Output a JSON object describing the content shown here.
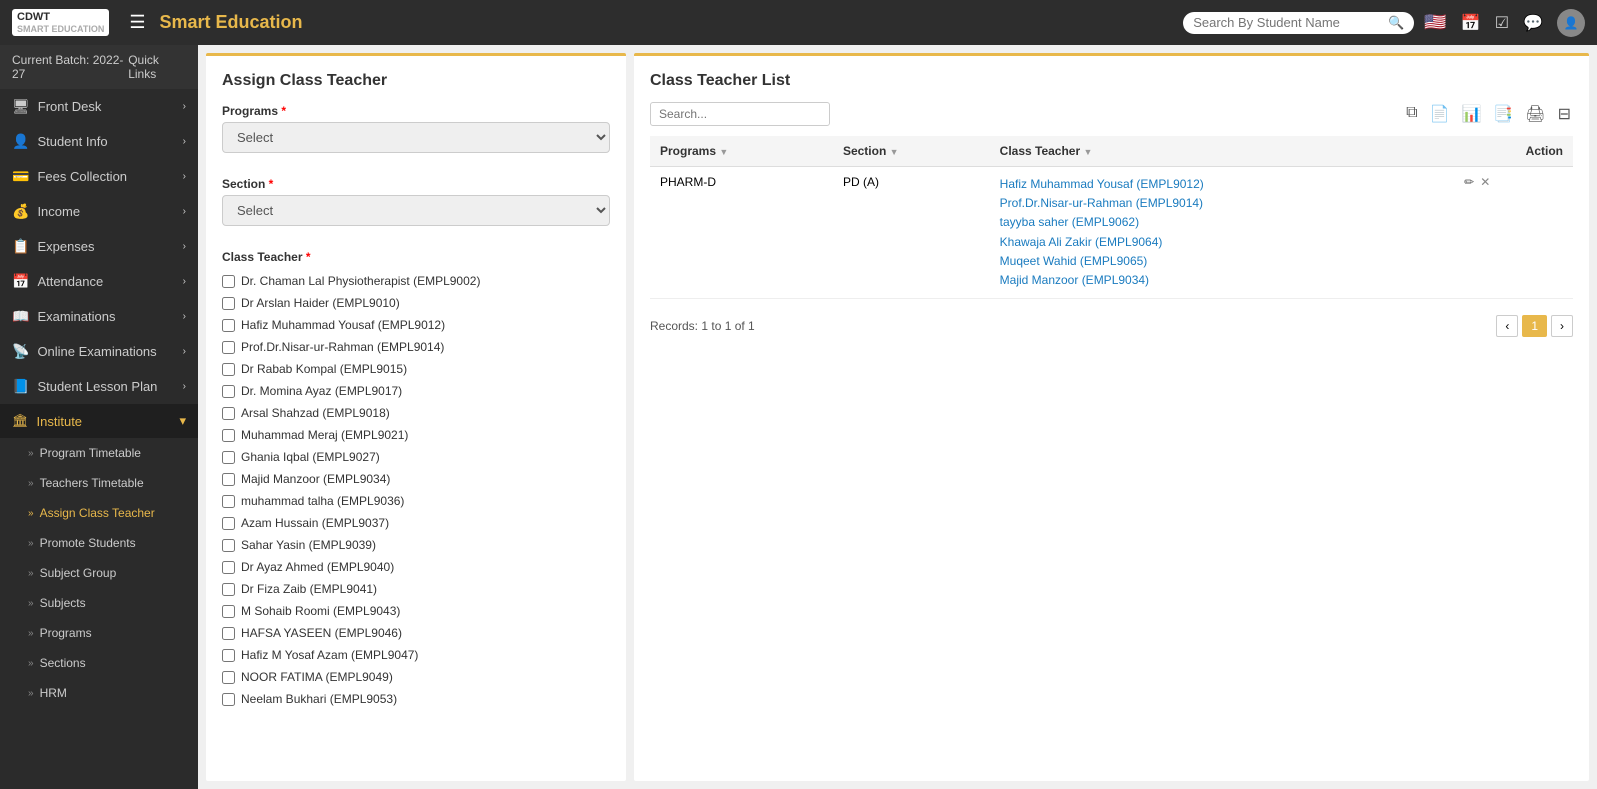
{
  "topnav": {
    "logo_line1": "CDWT",
    "logo_line2": "SMART EDUCATION",
    "app_title": "Smart Education",
    "search_placeholder": "Search By Student Name",
    "hamburger_label": "☰"
  },
  "sidebar": {
    "batch_label": "Current Batch: 2022-27",
    "quick_links_label": "Quick Links",
    "items": [
      {
        "id": "front-desk",
        "label": "Front Desk",
        "icon": "🖥",
        "has_chevron": true
      },
      {
        "id": "student-info",
        "label": "Student Info",
        "icon": "👤",
        "has_chevron": true
      },
      {
        "id": "fees-collection",
        "label": "Fees Collection",
        "icon": "💳",
        "has_chevron": true
      },
      {
        "id": "income",
        "label": "Income",
        "icon": "💰",
        "has_chevron": true
      },
      {
        "id": "expenses",
        "label": "Expenses",
        "icon": "📋",
        "has_chevron": true
      },
      {
        "id": "attendance",
        "label": "Attendance",
        "icon": "📅",
        "has_chevron": true
      },
      {
        "id": "examinations",
        "label": "Examinations",
        "icon": "📖",
        "has_chevron": true
      },
      {
        "id": "online-examinations",
        "label": "Online Examinations",
        "icon": "📡",
        "has_chevron": true
      },
      {
        "id": "student-lesson-plan",
        "label": "Student Lesson Plan",
        "icon": "📘",
        "has_chevron": true
      }
    ],
    "institute_label": "Institute",
    "sub_items": [
      {
        "id": "program-timetable",
        "label": "Program Timetable",
        "active": false
      },
      {
        "id": "teachers-timetable",
        "label": "Teachers Timetable",
        "active": false
      },
      {
        "id": "assign-class-teacher",
        "label": "Assign Class Teacher",
        "active": true
      },
      {
        "id": "promote-students",
        "label": "Promote Students",
        "active": false
      },
      {
        "id": "subject-group",
        "label": "Subject Group",
        "active": false
      },
      {
        "id": "subjects",
        "label": "Subjects",
        "active": false
      },
      {
        "id": "programs",
        "label": "Programs",
        "active": false
      },
      {
        "id": "sections",
        "label": "Sections",
        "active": false
      },
      {
        "id": "hrm",
        "label": "HRM",
        "active": false
      }
    ]
  },
  "assign_form": {
    "title": "Assign Class Teacher",
    "programs_label": "Programs",
    "programs_placeholder": "Select",
    "section_label": "Section",
    "section_placeholder": "Select",
    "class_teacher_label": "Class Teacher",
    "teachers": [
      "Dr. Chaman Lal Physiotherapist (EMPL9002)",
      "Dr Arslan Haider (EMPL9010)",
      "Hafiz Muhammad Yousaf (EMPL9012)",
      "Prof.Dr.Nisar-ur-Rahman (EMPL9014)",
      "Dr Rabab Kompal (EMPL9015)",
      "Dr. Momina Ayaz (EMPL9017)",
      "Arsal Shahzad (EMPL9018)",
      "Muhammad Meraj (EMPL9021)",
      "Ghania Iqbal (EMPL9027)",
      "Majid Manzoor (EMPL9034)",
      "muhammad talha (EMPL9036)",
      "Azam Hussain (EMPL9037)",
      "Sahar Yasin (EMPL9039)",
      "Dr Ayaz Ahmed (EMPL9040)",
      "Dr Fiza Zaib (EMPL9041)",
      "M Sohaib Roomi (EMPL9043)",
      "HAFSA YASEEN (EMPL9046)",
      "Hafiz M Yosaf Azam (EMPL9047)",
      "NOOR FATIMA (EMPL9049)",
      "Neelam Bukhari (EMPL9053)"
    ]
  },
  "class_teacher_list": {
    "title": "Class Teacher List",
    "search_placeholder": "Search...",
    "columns": [
      "Programs",
      "Section",
      "Class Teacher",
      "Action"
    ],
    "rows": [
      {
        "program": "PHARM-D",
        "section": "PD (A)",
        "teachers": [
          "Hafiz Muhammad Yousaf (EMPL9012)",
          "Prof.Dr.Nisar-ur-Rahman (EMPL9014)",
          "tayyba saher (EMPL9062)",
          "Khawaja Ali Zakir (EMPL9064)",
          "Muqeet Wahid (EMPL9065)",
          "Majid Manzoor (EMPL9034)"
        ]
      }
    ],
    "records_text": "Records: 1 to 1 of 1",
    "pagination": {
      "prev": "‹",
      "page": "1",
      "next": "›"
    }
  },
  "table_action_icons": [
    "⊞",
    "📄",
    "📋",
    "📑",
    "🖨",
    "⊟"
  ]
}
